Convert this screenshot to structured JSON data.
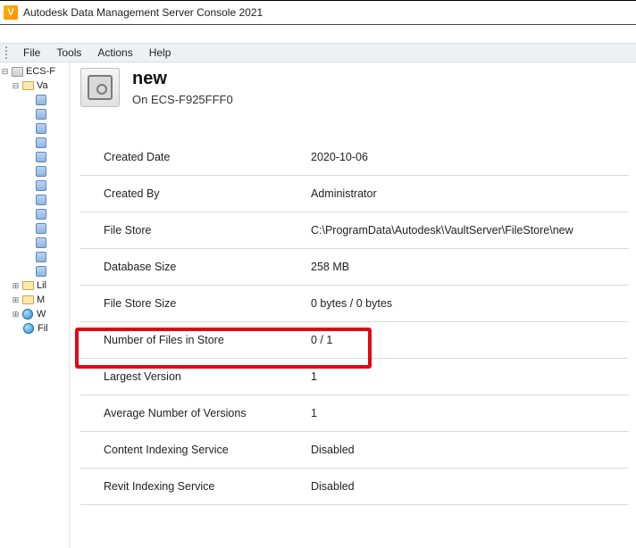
{
  "window": {
    "title": "Autodesk Data Management Server Console 2021"
  },
  "menu": {
    "file": "File",
    "tools": "Tools",
    "actions": "Actions",
    "help": "Help"
  },
  "tree": {
    "root": "ECS-F",
    "vaults": "Va",
    "items": [
      "",
      "",
      "",
      "",
      "",
      "",
      "",
      "",
      "",
      "",
      "",
      "",
      ""
    ],
    "lib": "Lil",
    "mgmt": "M",
    "w": "W",
    "fil": "Fil"
  },
  "header": {
    "title": "new",
    "subtitle_prefix": "On ",
    "subtitle_host": "ECS-F925FFF0"
  },
  "props": [
    {
      "label": "Created Date",
      "value": "2020-10-06"
    },
    {
      "label": "Created By",
      "value": "Administrator"
    },
    {
      "label": "File Store",
      "value": "C:\\ProgramData\\Autodesk\\VaultServer\\FileStore\\new"
    },
    {
      "label": "Database Size",
      "value": "258 MB"
    },
    {
      "label": "File Store Size",
      "value": "0 bytes / 0 bytes"
    },
    {
      "label": "Number of Files in Store",
      "value": "0 / 1"
    },
    {
      "label": "Largest Version",
      "value": "1"
    },
    {
      "label": "Average Number of Versions",
      "value": "1"
    },
    {
      "label": "Content Indexing Service",
      "value": "Disabled"
    },
    {
      "label": "Revit Indexing Service",
      "value": "Disabled"
    }
  ]
}
